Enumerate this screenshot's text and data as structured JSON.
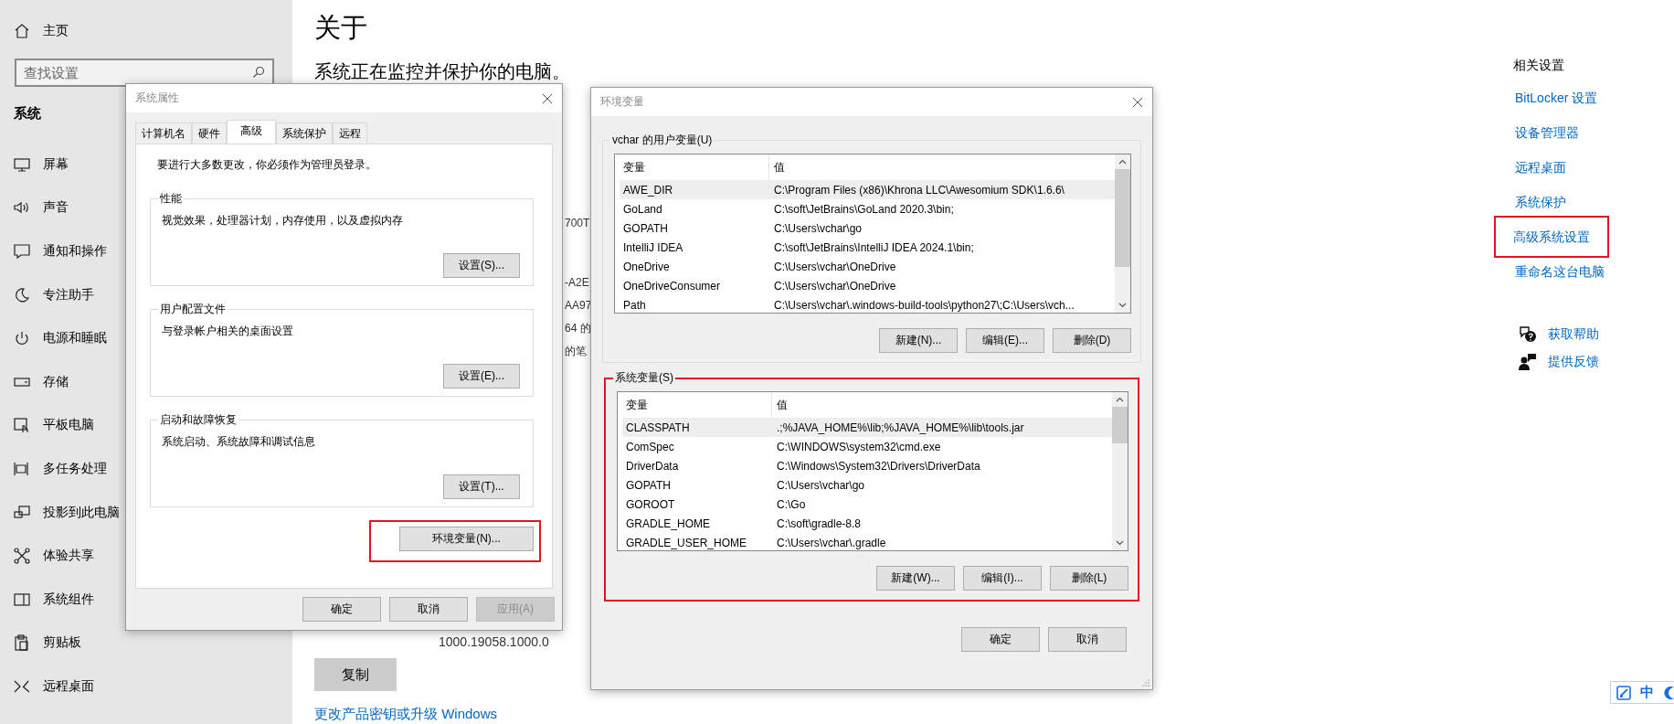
{
  "settings": {
    "sidebar": {
      "home": "主页",
      "search": {
        "placeholder": "查找设置"
      },
      "section": "系统",
      "items": [
        {
          "label": "屏幕",
          "kind": "monitor"
        },
        {
          "label": "声音",
          "kind": "sound"
        },
        {
          "label": "通知和操作",
          "kind": "notification"
        },
        {
          "label": "专注助手",
          "kind": "moon"
        },
        {
          "label": "电源和睡眠",
          "kind": "power"
        },
        {
          "label": "存储",
          "kind": "storage"
        },
        {
          "label": "平板电脑",
          "kind": "tablet"
        },
        {
          "label": "多任务处理",
          "kind": "multitask"
        },
        {
          "label": "投影到此电脑",
          "kind": "project"
        },
        {
          "label": "体验共享",
          "kind": "share"
        },
        {
          "label": "系统组件",
          "kind": "components"
        },
        {
          "label": "剪贴板",
          "kind": "clipboard"
        },
        {
          "label": "远程桌面",
          "kind": "remote"
        }
      ]
    },
    "main": {
      "title": "关于",
      "subtitle": "系统正在监控并保护你的电脑。",
      "fragments": [
        "700T",
        "-A2E",
        "AA97",
        "64 的",
        "的笔"
      ],
      "version": "1000.19058.1000.0",
      "copy_button": "复制",
      "upgrade_link": "更改产品密钥或升级 Windows"
    },
    "related": {
      "heading": "相关设置",
      "links": [
        {
          "label": "BitLocker 设置",
          "highlighted": false
        },
        {
          "label": "设备管理器",
          "highlighted": false
        },
        {
          "label": "远程桌面",
          "highlighted": false
        },
        {
          "label": "系统保护",
          "highlighted": false
        },
        {
          "label": "高级系统设置",
          "highlighted": true
        },
        {
          "label": "重命名这台电脑",
          "highlighted": false
        }
      ],
      "help": [
        {
          "label": "获取帮助",
          "kind": "help"
        },
        {
          "label": "提供反馈",
          "kind": "feedback"
        }
      ]
    }
  },
  "system_properties": {
    "title": "系统属性",
    "tabs": [
      {
        "label": "计算机名",
        "selected": false
      },
      {
        "label": "硬件",
        "selected": false
      },
      {
        "label": "高级",
        "selected": true
      },
      {
        "label": "系统保护",
        "selected": false
      },
      {
        "label": "远程",
        "selected": false
      }
    ],
    "note": "要进行大多数更改，你必须作为管理员登录。",
    "groups": [
      {
        "title": "性能",
        "description": "视觉效果，处理器计划，内存使用，以及虚拟内存",
        "button": "设置(S)..."
      },
      {
        "title": "用户配置文件",
        "description": "与登录帐户相关的桌面设置",
        "button": "设置(E)..."
      },
      {
        "title": "启动和故障恢复",
        "description": "系统启动、系统故障和调试信息",
        "button": "设置(T)..."
      }
    ],
    "env_button": {
      "label": "环境变量(N)...",
      "highlighted": true
    },
    "buttons": [
      {
        "label": "确定",
        "disabled": false
      },
      {
        "label": "取消",
        "disabled": false
      },
      {
        "label": "应用(A)",
        "disabled": true
      }
    ]
  },
  "environment_variables": {
    "title": "环境变量",
    "sections": [
      {
        "title": "vchar 的用户变量(U)",
        "highlighted": false,
        "columns": [
          "变量",
          "值"
        ],
        "rows": [
          {
            "name": "AWE_DIR",
            "value": "C:\\Program Files (x86)\\Khrona LLC\\Awesomium SDK\\1.6.6\\",
            "selected": true
          },
          {
            "name": "GoLand",
            "value": "C:\\soft\\JetBrains\\GoLand 2020.3\\bin;",
            "selected": false
          },
          {
            "name": "GOPATH",
            "value": "C:\\Users\\vchar\\go",
            "selected": false
          },
          {
            "name": "IntelliJ IDEA",
            "value": "C:\\soft\\JetBrains\\IntelliJ IDEA 2024.1\\bin;",
            "selected": false
          },
          {
            "name": "OneDrive",
            "value": "C:\\Users\\vchar\\OneDrive",
            "selected": false
          },
          {
            "name": "OneDriveConsumer",
            "value": "C:\\Users\\vchar\\OneDrive",
            "selected": false
          },
          {
            "name": "Path",
            "value": "C:\\Users\\vchar\\.windows-build-tools\\python27\\;C:\\Users\\vch...",
            "selected": false
          }
        ],
        "buttons": [
          "新建(N)...",
          "编辑(E)...",
          "删除(D)"
        ]
      },
      {
        "title": "系统变量(S)",
        "highlighted": true,
        "columns": [
          "变量",
          "值"
        ],
        "rows": [
          {
            "name": "CLASSPATH",
            "value": ".;%JAVA_HOME%\\lib;%JAVA_HOME%\\lib\\tools.jar",
            "selected": true
          },
          {
            "name": "ComSpec",
            "value": "C:\\WINDOWS\\system32\\cmd.exe",
            "selected": false
          },
          {
            "name": "DriverData",
            "value": "C:\\Windows\\System32\\Drivers\\DriverData",
            "selected": false
          },
          {
            "name": "GOPATH",
            "value": "C:\\Users\\vchar\\go",
            "selected": false
          },
          {
            "name": "GOROOT",
            "value": "C:\\Go",
            "selected": false
          },
          {
            "name": "GRADLE_HOME",
            "value": "C:\\soft\\gradle-8.8",
            "selected": false
          },
          {
            "name": "GRADLE_USER_HOME",
            "value": "C:\\Users\\vchar\\.gradle",
            "selected": false
          }
        ],
        "buttons": [
          "新建(W)...",
          "编辑(I)...",
          "删除(L)"
        ]
      }
    ],
    "buttons": [
      "确定",
      "取消"
    ]
  },
  "tray": {
    "ime": "中"
  }
}
